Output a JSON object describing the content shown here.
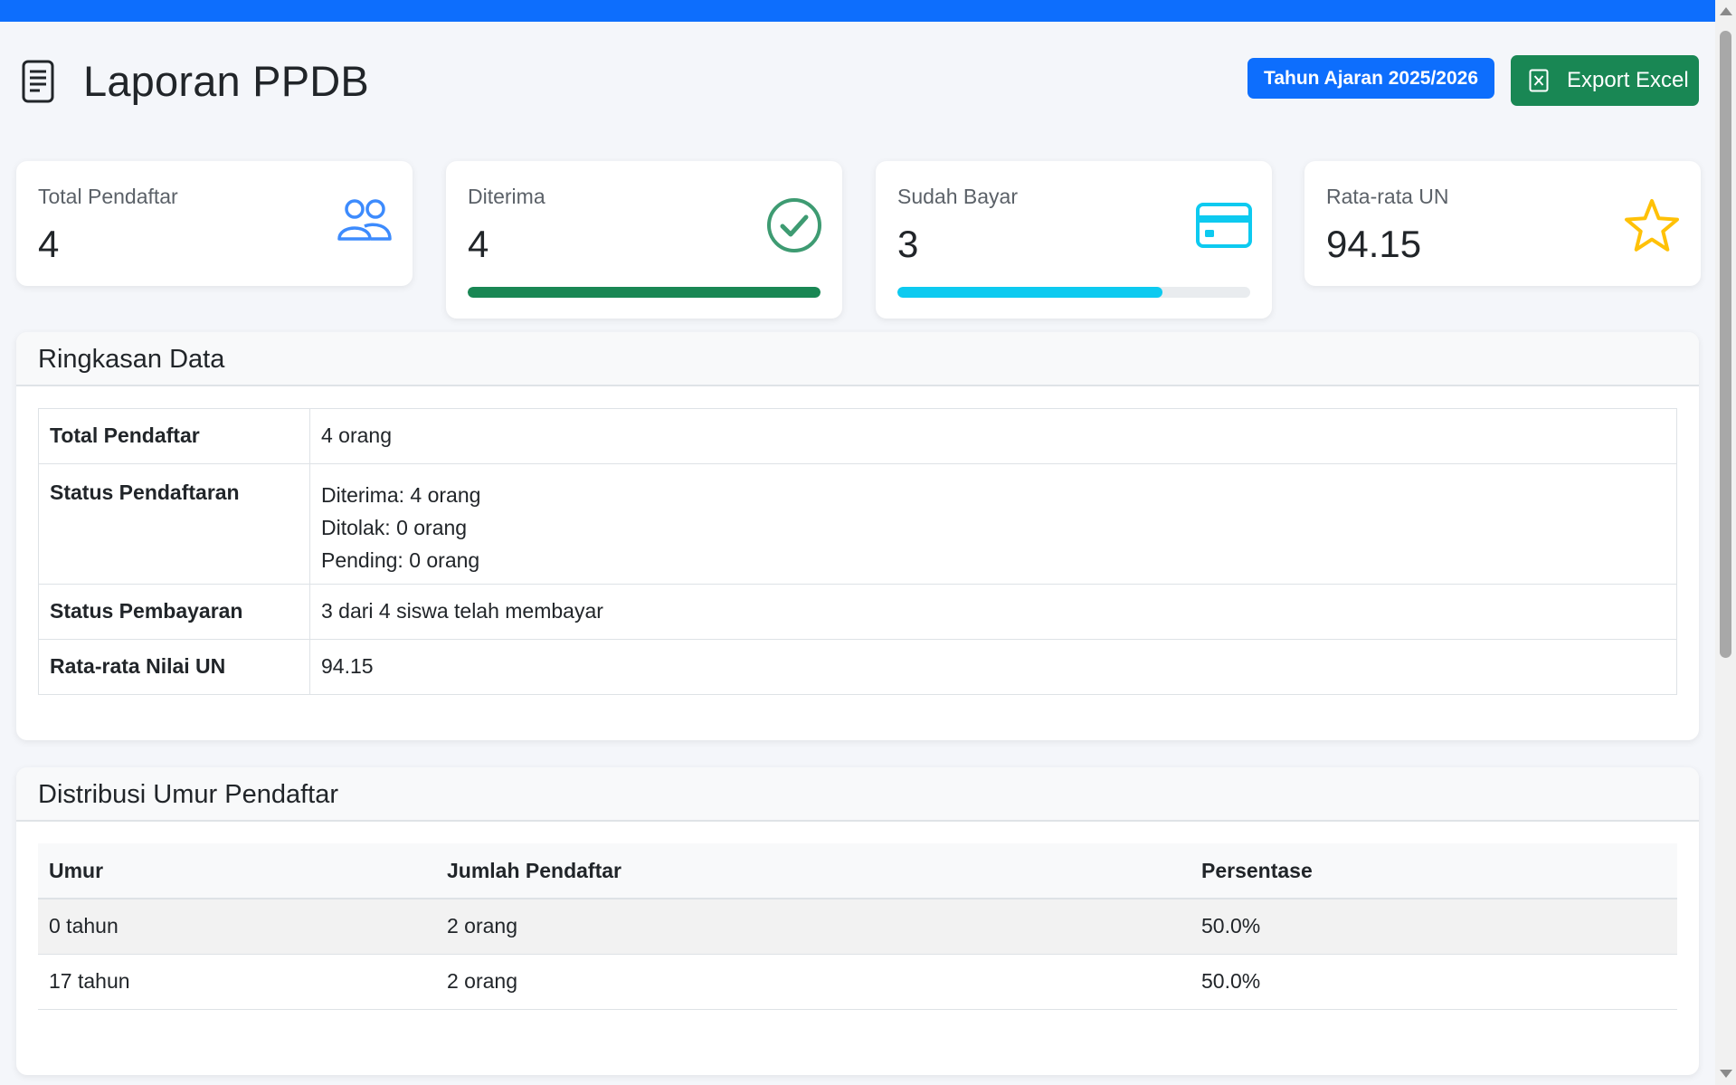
{
  "page": {
    "title": "Laporan PPDB",
    "year_badge": "Tahun Ajaran 2025/2026",
    "export_label": "Export Excel",
    "colors": {
      "primary": "#0d6efd",
      "success": "#198754",
      "info": "#0dcaf0",
      "warning": "#ffc107"
    }
  },
  "stats": [
    {
      "label": "Total Pendaftar",
      "value": "4",
      "icon": "people-icon"
    },
    {
      "label": "Diterima",
      "value": "4",
      "icon": "check-circle-icon",
      "progress": 1.0
    },
    {
      "label": "Sudah Bayar",
      "value": "3",
      "icon": "credit-card-icon",
      "progress": 0.75
    },
    {
      "label": "Rata-rata UN",
      "value": "94.15",
      "icon": "star-icon"
    }
  ],
  "summary": {
    "title": "Ringkasan Data",
    "rows": [
      {
        "key": "Total Pendaftar",
        "lines": [
          "4 orang"
        ]
      },
      {
        "key": "Status Pendaftaran",
        "lines": [
          "Diterima: 4 orang",
          "Ditolak: 0 orang",
          "Pending: 0 orang"
        ]
      },
      {
        "key": "Status Pembayaran",
        "lines": [
          "3 dari 4 siswa telah membayar"
        ]
      },
      {
        "key": "Rata-rata Nilai UN",
        "lines": [
          "94.15"
        ]
      }
    ]
  },
  "age_distribution": {
    "title": "Distribusi Umur Pendaftar",
    "headers": [
      "Umur",
      "Jumlah Pendaftar",
      "Persentase"
    ],
    "rows": [
      [
        "0 tahun",
        "2 orang",
        "50.0%"
      ],
      [
        "17 tahun",
        "2 orang",
        "50.0%"
      ]
    ]
  }
}
